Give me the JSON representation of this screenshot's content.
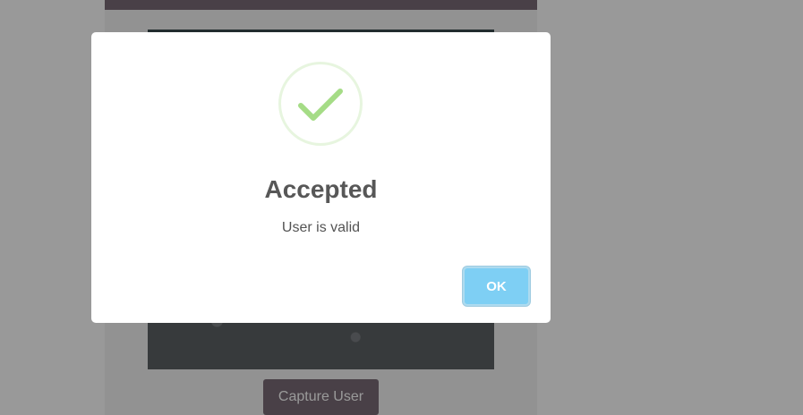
{
  "app": {
    "capture_button_label": "Capture User"
  },
  "dialog": {
    "icon": "check-icon",
    "title": "Accepted",
    "message": "User is valid",
    "ok_label": "OK",
    "colors": {
      "check": "#a5dc86",
      "check_ring": "#e7f5df",
      "ok_button": "#7ecff4",
      "overlay": "rgba(0,0,0,0.4)"
    }
  }
}
